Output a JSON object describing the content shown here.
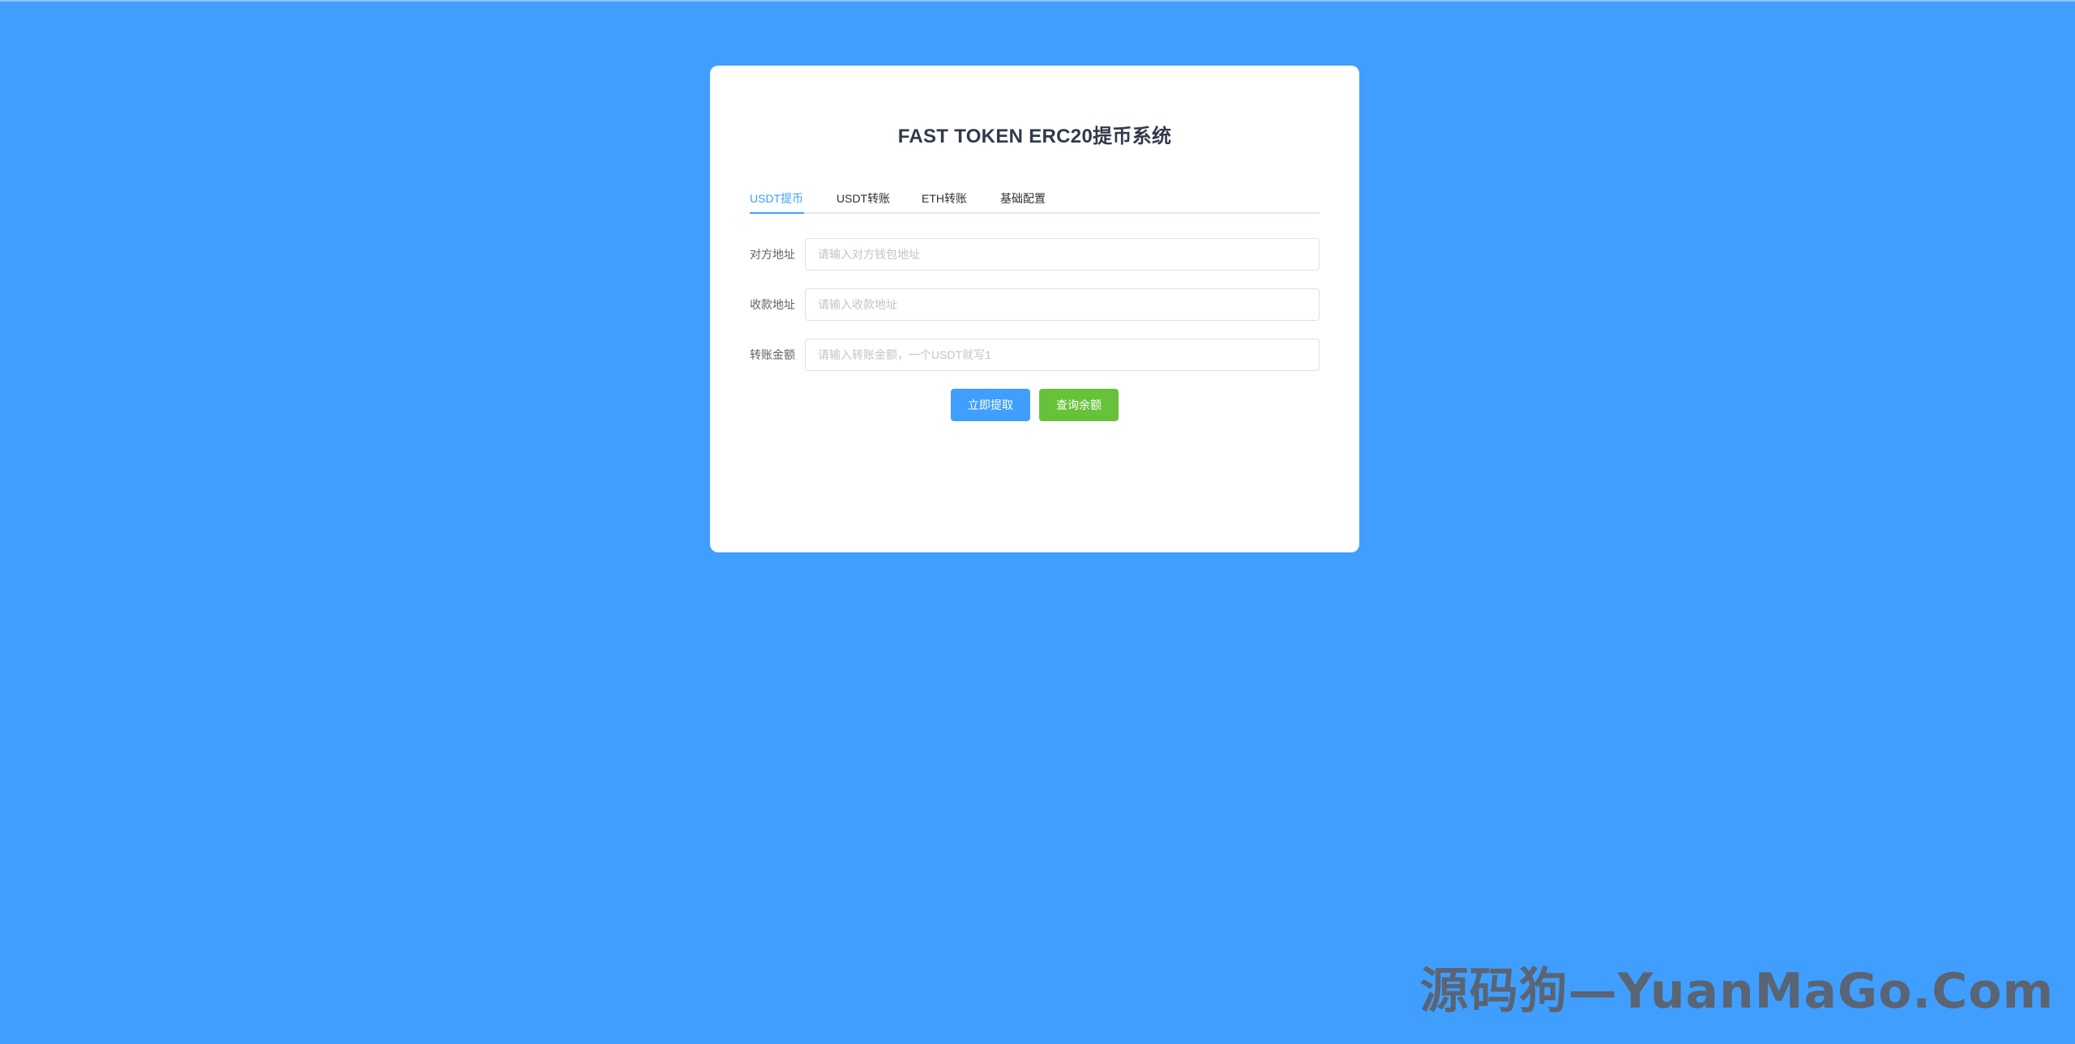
{
  "app": {
    "title": "FAST TOKEN ERC20提币系统"
  },
  "tabs": [
    {
      "label": "USDT提币",
      "active": true
    },
    {
      "label": "USDT转账",
      "active": false
    },
    {
      "label": "ETH转账",
      "active": false
    },
    {
      "label": "基础配置",
      "active": false
    }
  ],
  "form": {
    "fields": [
      {
        "label": "对方地址",
        "value": "",
        "placeholder": "请输入对方钱包地址"
      },
      {
        "label": "收款地址",
        "value": "",
        "placeholder": "请输入收款地址"
      },
      {
        "label": "转账金额",
        "value": "",
        "placeholder": "请输入转账金额，一个USDT就写1"
      }
    ]
  },
  "buttons": {
    "withdraw_label": "立即提取",
    "query_label": "查询余额"
  },
  "watermark": {
    "text": "源码狗—YuanMaGo.Com"
  },
  "colors": {
    "background": "#409eff",
    "primary": "#409eff",
    "success": "#67c23a",
    "card": "#ffffff"
  }
}
